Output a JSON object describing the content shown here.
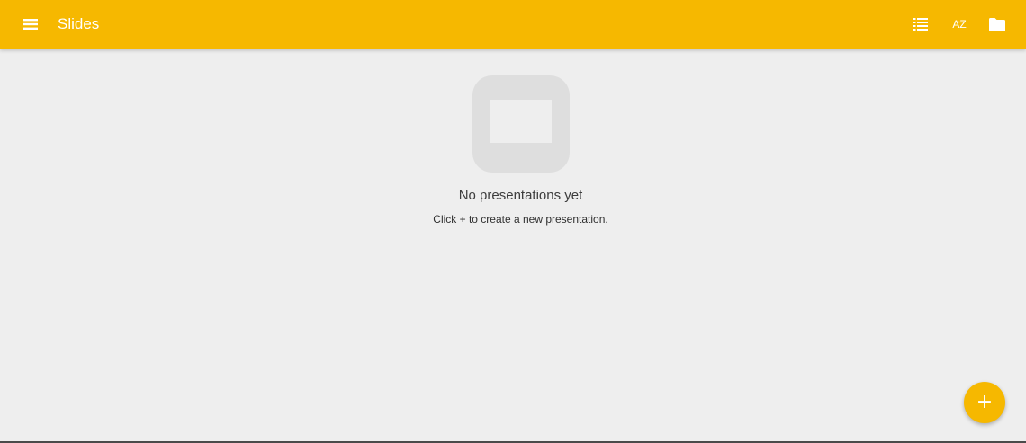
{
  "app": {
    "title": "Slides",
    "accent_color": "#f6b800"
  },
  "toolbar": {
    "menu_icon": "hamburger-menu-icon",
    "actions": [
      {
        "name": "list-view",
        "icon": "list-view-icon"
      },
      {
        "name": "sort-az",
        "icon": "sort-alphabetical-icon",
        "label": "AZ"
      },
      {
        "name": "open-folder",
        "icon": "folder-icon"
      }
    ]
  },
  "empty_state": {
    "icon": "presentation-placeholder-icon",
    "title": "No presentations yet",
    "hint": "Click + to create a new presentation."
  },
  "fab": {
    "label": "+",
    "icon": "add-icon"
  }
}
